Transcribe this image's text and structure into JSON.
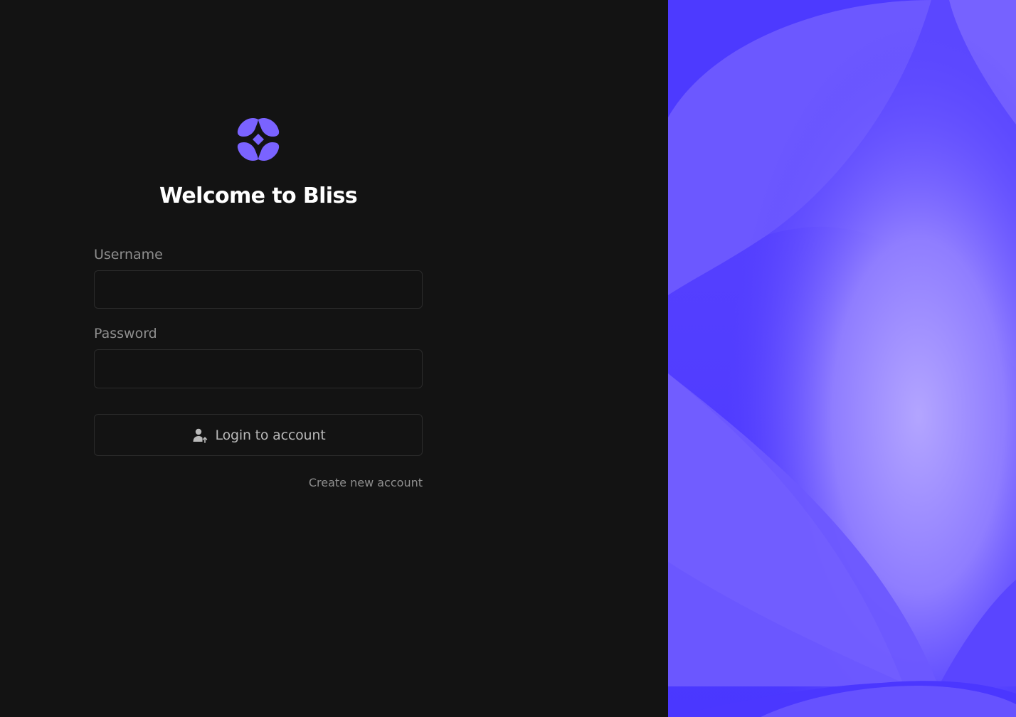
{
  "app": {
    "logo_icon": "bliss-flower-logo-icon",
    "title": "Welcome to Bliss"
  },
  "form": {
    "username_label": "Username",
    "username_value": "",
    "password_label": "Password",
    "password_value": "",
    "login_button_label": "Login to account",
    "login_button_icon": "user-arrow-up-icon",
    "create_account_link": "Create new account"
  },
  "colors": {
    "background": "#131313",
    "accent": "#5b45ff",
    "accent_light": "#a996ff",
    "text_primary": "#ffffff",
    "text_muted": "#8e8e8e"
  }
}
